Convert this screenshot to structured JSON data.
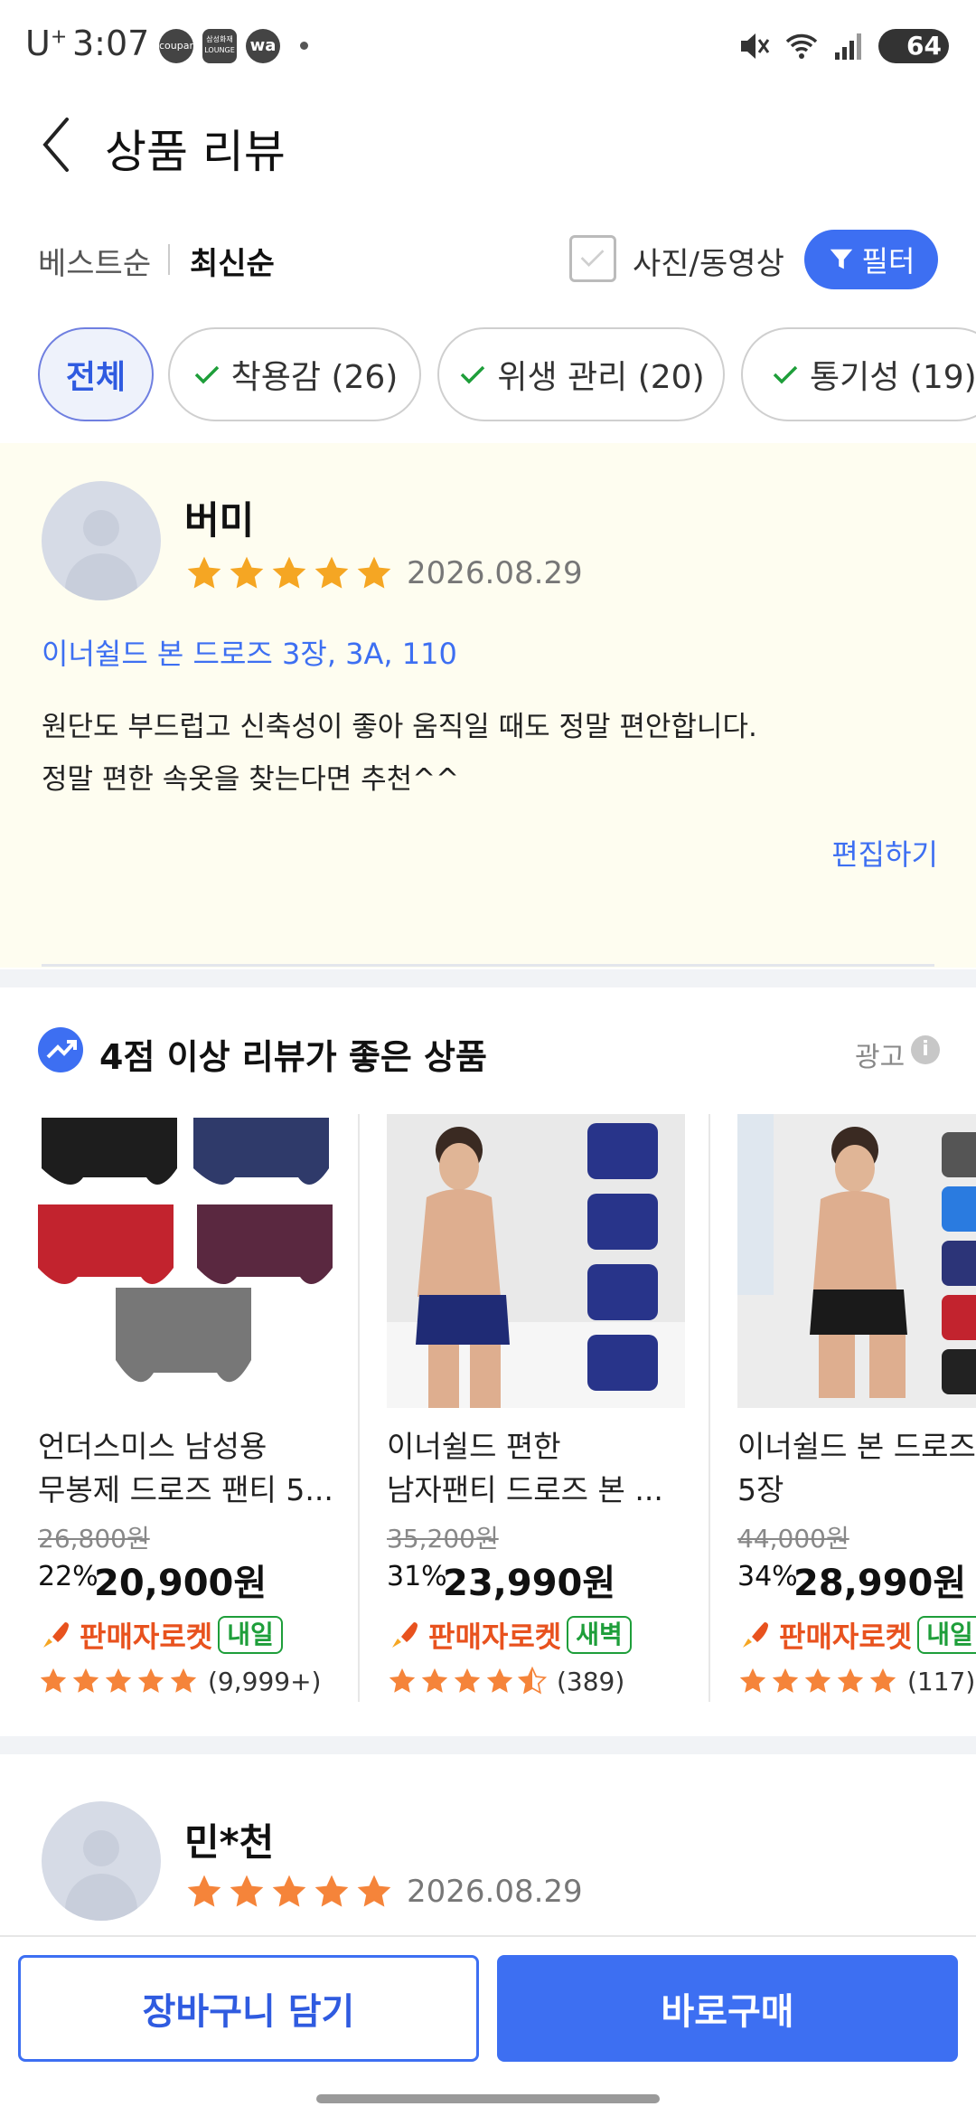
{
  "status_bar": {
    "carrier": "U",
    "carrier_sup": "+",
    "time": "3:07",
    "app_icons": [
      "coupang eats",
      "삼성화재 LOUNGE",
      "wa"
    ],
    "battery": "64"
  },
  "header": {
    "title": "상품 리뷰"
  },
  "sort": {
    "best": "베스트순",
    "newest": "최신순",
    "photo_video": "사진/동영상",
    "filter": "필터"
  },
  "chips": [
    {
      "label": "전체",
      "active": true
    },
    {
      "label": "착용감 (26)",
      "active": false
    },
    {
      "label": "위생 관리 (20)",
      "active": false
    },
    {
      "label": "통기성 (19)",
      "active": false
    }
  ],
  "review1": {
    "name": "버미",
    "rating": 5,
    "date": "2026.08.29",
    "option": "이너쉴드 본 드로즈 3장, 3A, 110",
    "text_line1": "원단도 부드럽고 신축성이 좋아 움직일 때도 정말 편안합니다.",
    "text_line2": "정말 편한 속옷을 찾는다면 추천^^",
    "edit": "편집하기"
  },
  "recommend": {
    "title": "4점 이상 리뷰가 좋은 상품",
    "ad": "광고",
    "products": [
      {
        "name_line1": "언더스미스 남성용",
        "name_line2": "무봉제 드로즈 팬티 5...",
        "original_price": "26,800원",
        "discount": "22%",
        "price": "20,900원",
        "rocket": "판매자로켓",
        "delivery": "내일",
        "rating": 5,
        "review_count": "(9,999+)"
      },
      {
        "name_line1": "이너쉴드 편한",
        "name_line2": "남자팬티 드로즈 본 ...",
        "original_price": "35,200원",
        "discount": "31%",
        "price": "23,990원",
        "rocket": "판매자로켓",
        "delivery": "새벽",
        "rating": 4.5,
        "review_count": "(389)"
      },
      {
        "name_line1": "이너쉴드 본 드로즈",
        "name_line2": "5장",
        "original_price": "44,000원",
        "discount": "34%",
        "price": "28,990원",
        "rocket": "판매자로켓",
        "delivery": "내일",
        "rating": 5,
        "review_count": "(117)"
      }
    ]
  },
  "review2": {
    "name": "민*천",
    "rating": 5,
    "date": "2026.08.29"
  },
  "bottom": {
    "cart": "장바구니 담기",
    "buy": "바로구매"
  },
  "colors": {
    "accent": "#3d6ff2",
    "star": "#f5a623",
    "rocket": "#e8521e",
    "badge_green": "#1e9e3a",
    "review_bg": "#fefdf0"
  }
}
